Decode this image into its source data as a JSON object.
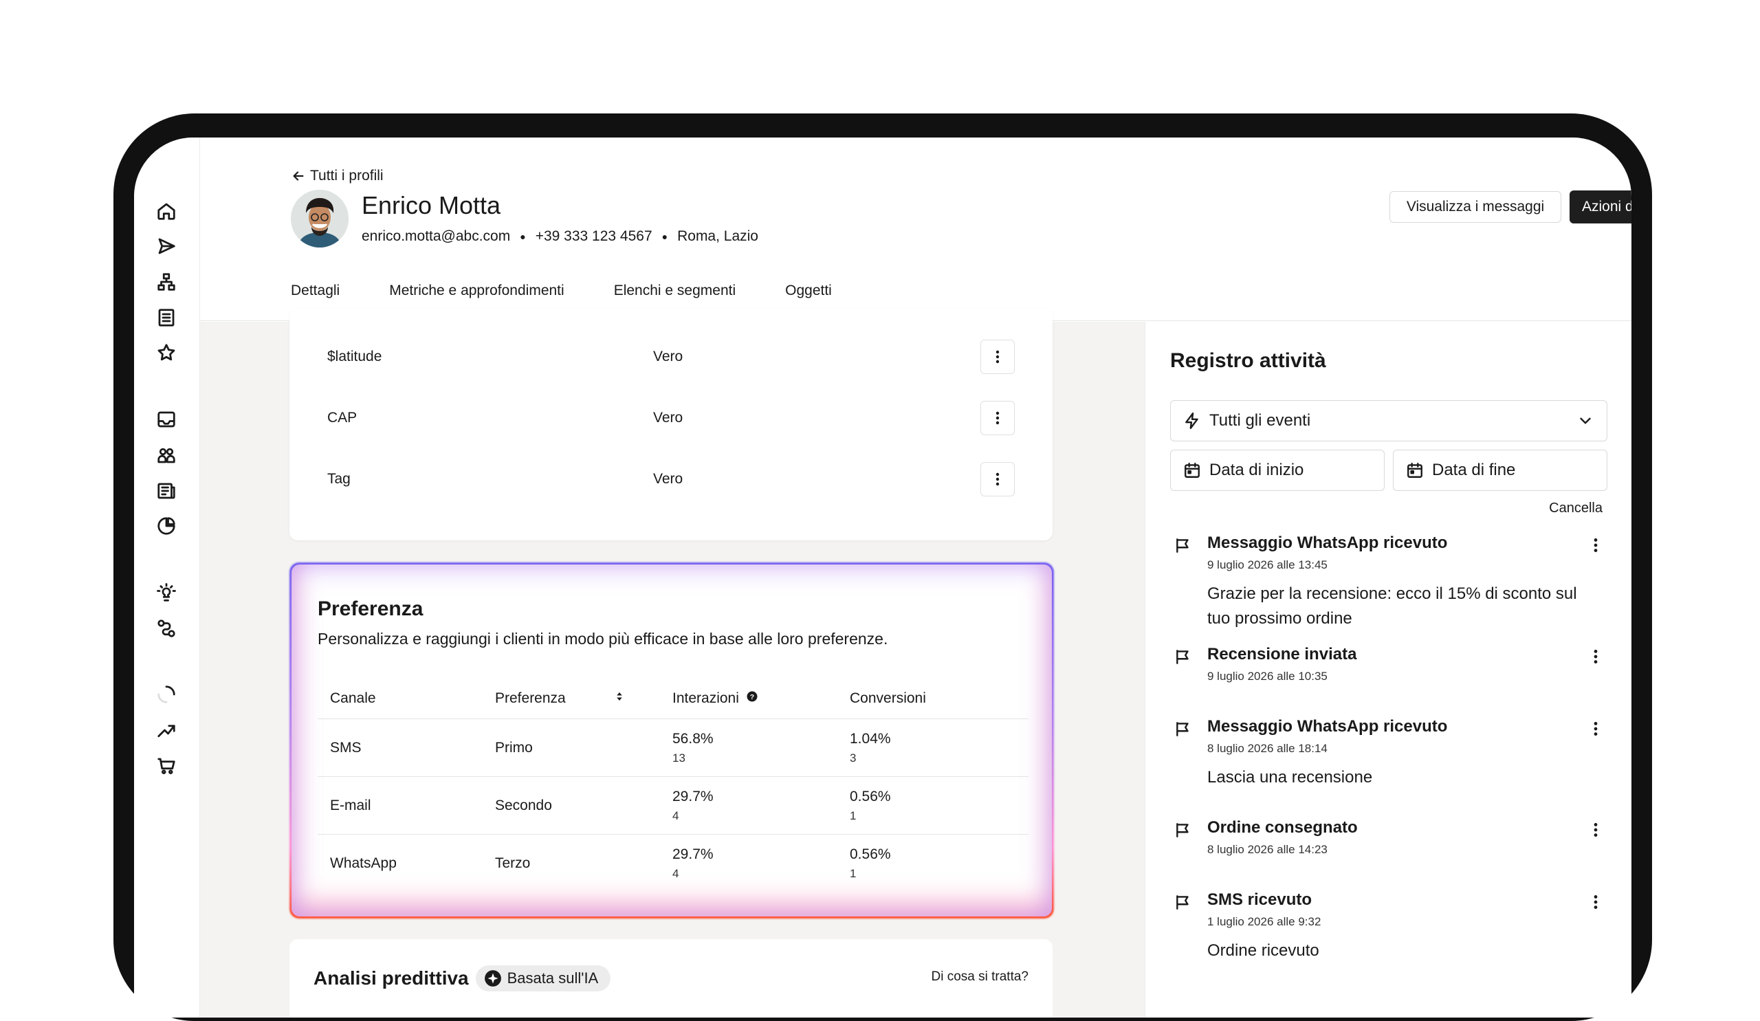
{
  "header": {
    "back_label": "Tutti i profili",
    "profile_name": "Enrico Motta",
    "email": "enrico.motta@abc.com",
    "phone": "+39 333 123 4567",
    "location": "Roma, Lazio",
    "view_messages_label": "Visualizza i messaggi",
    "profile_actions_label": "Azioni del profilo"
  },
  "tabs": [
    {
      "label": "Dettagli",
      "active": false
    },
    {
      "label": "Metriche e approfondimenti",
      "active": true
    },
    {
      "label": "Elenchi e segmenti",
      "active": false
    },
    {
      "label": "Oggetti",
      "active": false
    }
  ],
  "attributes": [
    {
      "key": "$latitude",
      "value": "Vero"
    },
    {
      "key": "CAP",
      "value": "Vero"
    },
    {
      "key": "Tag",
      "value": "Vero"
    }
  ],
  "preference": {
    "title": "Preferenza",
    "subtitle": "Personalizza e raggiungi i clienti in modo più efficace in base alle loro preferenze.",
    "columns": [
      "Canale",
      "Preferenza",
      "Interazioni",
      "Conversioni"
    ],
    "rows": [
      {
        "channel": "SMS",
        "preference": "Primo",
        "interactions": "56.8%",
        "interactions_count": "13",
        "conversions": "1.04%",
        "conversions_count": "3"
      },
      {
        "channel": "E-mail",
        "preference": "Secondo",
        "interactions": "29.7%",
        "interactions_count": "4",
        "conversions": "0.56%",
        "conversions_count": "1"
      },
      {
        "channel": "WhatsApp",
        "preference": "Terzo",
        "interactions": "29.7%",
        "interactions_count": "4",
        "conversions": "0.56%",
        "conversions_count": "1"
      }
    ]
  },
  "predictive": {
    "title": "Analisi predittiva",
    "badge": "Basata sull'IA",
    "link": "Di cosa si tratta?"
  },
  "activity": {
    "title": "Registro attività",
    "filter_value": "Tutti gli eventi",
    "start_date_label": "Data di inizio",
    "end_date_label": "Data di fine",
    "cancel_label": "Cancella",
    "events": [
      {
        "title": "Messaggio WhatsApp ricevuto",
        "date": "9 luglio 2026 alle 13:45",
        "body": "Grazie per la recensione: ecco il 15% di sconto sul tuo prossimo ordine"
      },
      {
        "title": "Recensione inviata",
        "date": "9 luglio 2026 alle 10:35",
        "body": ""
      },
      {
        "title": "Messaggio WhatsApp ricevuto",
        "date": "8 luglio 2026 alle 18:14",
        "body": "Lascia una recensione"
      },
      {
        "title": "Ordine consegnato",
        "date": "8 luglio 2026 alle 14:23",
        "body": ""
      },
      {
        "title": "SMS ricevuto",
        "date": "1 luglio 2026 alle 9:32",
        "body": "Ordine ricevuto"
      }
    ]
  },
  "rail_icons": [
    "home-icon",
    "send-icon",
    "sitemap-icon",
    "list-icon",
    "star-icon",
    "inbox-icon",
    "people-icon",
    "news-icon",
    "pie-chart-icon",
    "bulb-icon",
    "flow-icon",
    "spinner-icon",
    "trend-icon",
    "cart-icon"
  ]
}
